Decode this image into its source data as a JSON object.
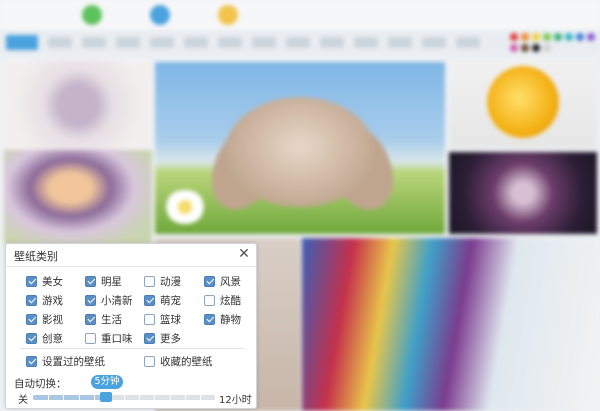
{
  "dialog": {
    "title": "壁纸类别",
    "close_glyph": "✕",
    "categories": [
      {
        "label": "美女",
        "checked": true
      },
      {
        "label": "明星",
        "checked": true
      },
      {
        "label": "动漫",
        "checked": false
      },
      {
        "label": "风景",
        "checked": true
      },
      {
        "label": "游戏",
        "checked": true
      },
      {
        "label": "小清新",
        "checked": true
      },
      {
        "label": "萌宠",
        "checked": true
      },
      {
        "label": "炫酷",
        "checked": false
      },
      {
        "label": "影视",
        "checked": true
      },
      {
        "label": "生活",
        "checked": true
      },
      {
        "label": "篮球",
        "checked": false
      },
      {
        "label": "静物",
        "checked": true
      },
      {
        "label": "创意",
        "checked": true
      },
      {
        "label": "重口味",
        "checked": false
      },
      {
        "label": "更多",
        "checked": true
      }
    ],
    "options": [
      {
        "label": "设置过的壁纸",
        "checked": true
      },
      {
        "label": "收藏的壁纸",
        "checked": false
      }
    ],
    "auto_switch": {
      "label": "自动切换：",
      "value_label": "5分钟",
      "min_label": "关",
      "max_label": "12小时",
      "position": 0.4
    }
  },
  "colors": {
    "accent": "#4aa3df",
    "checkbox_checked": "#5b8fc7"
  },
  "palette_colors": [
    "#e33b3b",
    "#f08a2c",
    "#f2d23c",
    "#7cc94f",
    "#3ab07a",
    "#32b6c8",
    "#3e7fd8",
    "#8b5bd1",
    "#d65aa8",
    "#6b4a2f",
    "#222222",
    "#cfcfcf"
  ]
}
